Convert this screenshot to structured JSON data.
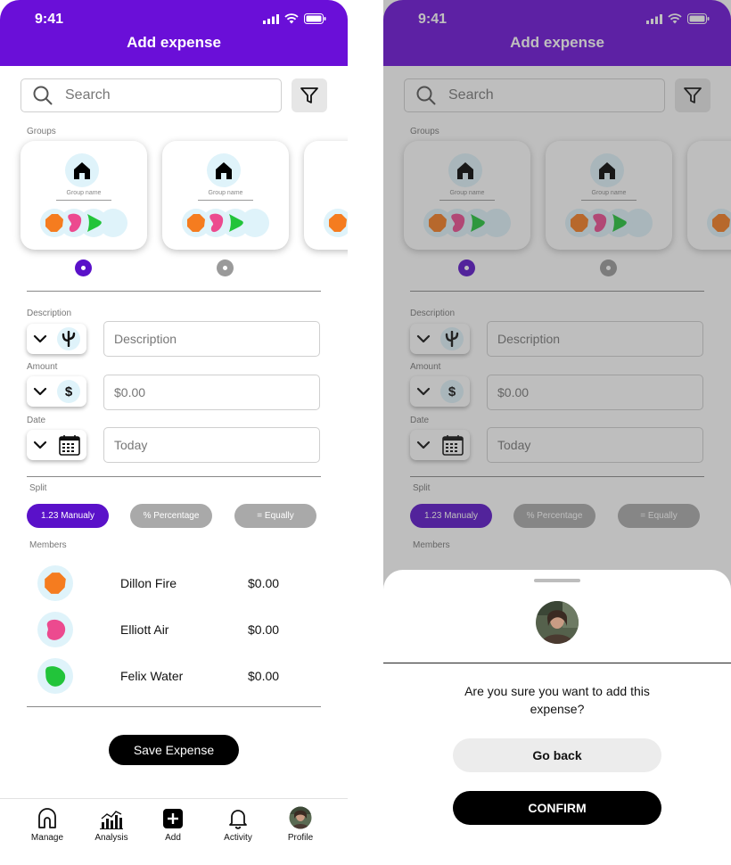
{
  "status_bar": {
    "time": "9:41"
  },
  "header": {
    "title": "Add expense"
  },
  "search": {
    "placeholder": "Search"
  },
  "groups": {
    "label": "Groups",
    "cards": [
      {
        "name": "Group name"
      },
      {
        "name": "Group name"
      }
    ]
  },
  "form": {
    "description": {
      "label": "Description",
      "placeholder": "Description",
      "icon": "cactus-icon"
    },
    "amount": {
      "label": "Amount",
      "placeholder": "$0.00",
      "icon": "dollar-icon",
      "icon_text": "$"
    },
    "date": {
      "label": "Date",
      "placeholder": "Today",
      "icon": "calendar-icon"
    }
  },
  "split": {
    "label": "Split",
    "options": [
      {
        "label": "1.23 Manualy",
        "active": true
      },
      {
        "label": "% Percentage",
        "active": false
      },
      {
        "label": "= Equally",
        "active": false
      }
    ]
  },
  "members": {
    "label": "Members",
    "list": [
      {
        "name": "Dillon Fire",
        "amount": "$0.00",
        "color": "#f57c1f"
      },
      {
        "name": "Elliott Air",
        "amount": "$0.00",
        "color": "#ec4a8f"
      },
      {
        "name": "Felix Water",
        "amount": "$0.00",
        "color": "#22c43a"
      }
    ]
  },
  "save_button": "Save Expense",
  "bottom_nav": [
    {
      "label": "Manage",
      "icon": "home-icon"
    },
    {
      "label": "Analysis",
      "icon": "chart-icon"
    },
    {
      "label": "Add",
      "icon": "plus-square-icon"
    },
    {
      "label": "Activity",
      "icon": "bell-icon"
    },
    {
      "label": "Profile",
      "icon": "avatar"
    }
  ],
  "confirm_sheet": {
    "question": "Are you sure you want to add this expense?",
    "go_back": "Go back",
    "confirm": "CONFIRM"
  },
  "colors": {
    "brand": "#6a0fd8",
    "accent": "#5a11c9",
    "avatar_bg": "#dff3fa",
    "orange": "#f57c1f",
    "pink": "#ec4a8f",
    "green": "#22c43a"
  }
}
